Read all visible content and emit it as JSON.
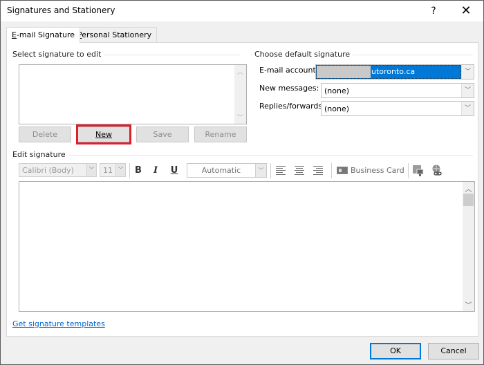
{
  "window": {
    "title": "Signatures and Stationery",
    "help_label": "?",
    "close_label": "✕"
  },
  "tabs": [
    {
      "label_prefix": "",
      "label_accel": "E",
      "label_rest": "-mail Signature",
      "active": true
    },
    {
      "label_prefix": "",
      "label_accel": "P",
      "label_rest": "ersonal Stationery",
      "active": false
    }
  ],
  "select_signature": {
    "group_label": "Select signature to edit",
    "items": [],
    "buttons": {
      "delete": "Delete",
      "new": "New",
      "save": "Save",
      "rename": "Rename"
    },
    "highlighted_button": "new"
  },
  "default_signature": {
    "group_label": "Choose default signature",
    "email_account_label": "E-mail account:",
    "email_account_value": "utoronto.ca",
    "new_messages_label": "New messages:",
    "new_messages_value": "(none)",
    "replies_label": "Replies/forwards:",
    "replies_value": "(none)"
  },
  "edit_signature": {
    "group_label": "Edit signature",
    "font_name": "Calibri (Body)",
    "font_size": "11",
    "bold_label": "B",
    "italic_label": "I",
    "underline_label": "U",
    "color_value": "Automatic",
    "business_card_label": "Business Card",
    "content": ""
  },
  "templates_link": "Get signature templates",
  "footer": {
    "ok_label": "OK",
    "cancel_label": "Cancel"
  },
  "colors": {
    "highlight": "#e11d2c",
    "accent": "#0078d7",
    "link": "#0066cc"
  }
}
